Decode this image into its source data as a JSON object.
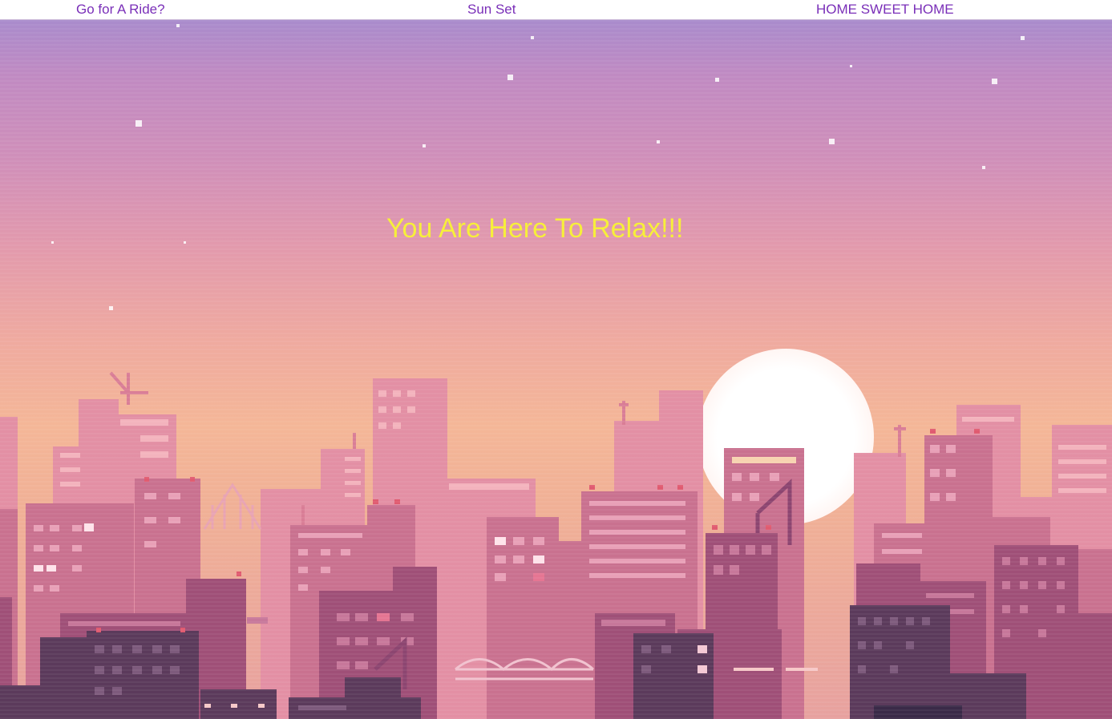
{
  "nav": {
    "items": [
      {
        "label": "Go for A Ride?"
      },
      {
        "label": "Sun Set"
      },
      {
        "label": "HOME SWEET HOME"
      }
    ]
  },
  "hero": {
    "headline": "You Are Here To Relax!!!",
    "headline_color": "#f7ef3a",
    "background_image": "pixel-art-city-skyline-sunset"
  },
  "colors": {
    "nav_link": "#7a2fb8",
    "sky_top": "#a98bcc",
    "sky_bottom": "#f4b697"
  }
}
